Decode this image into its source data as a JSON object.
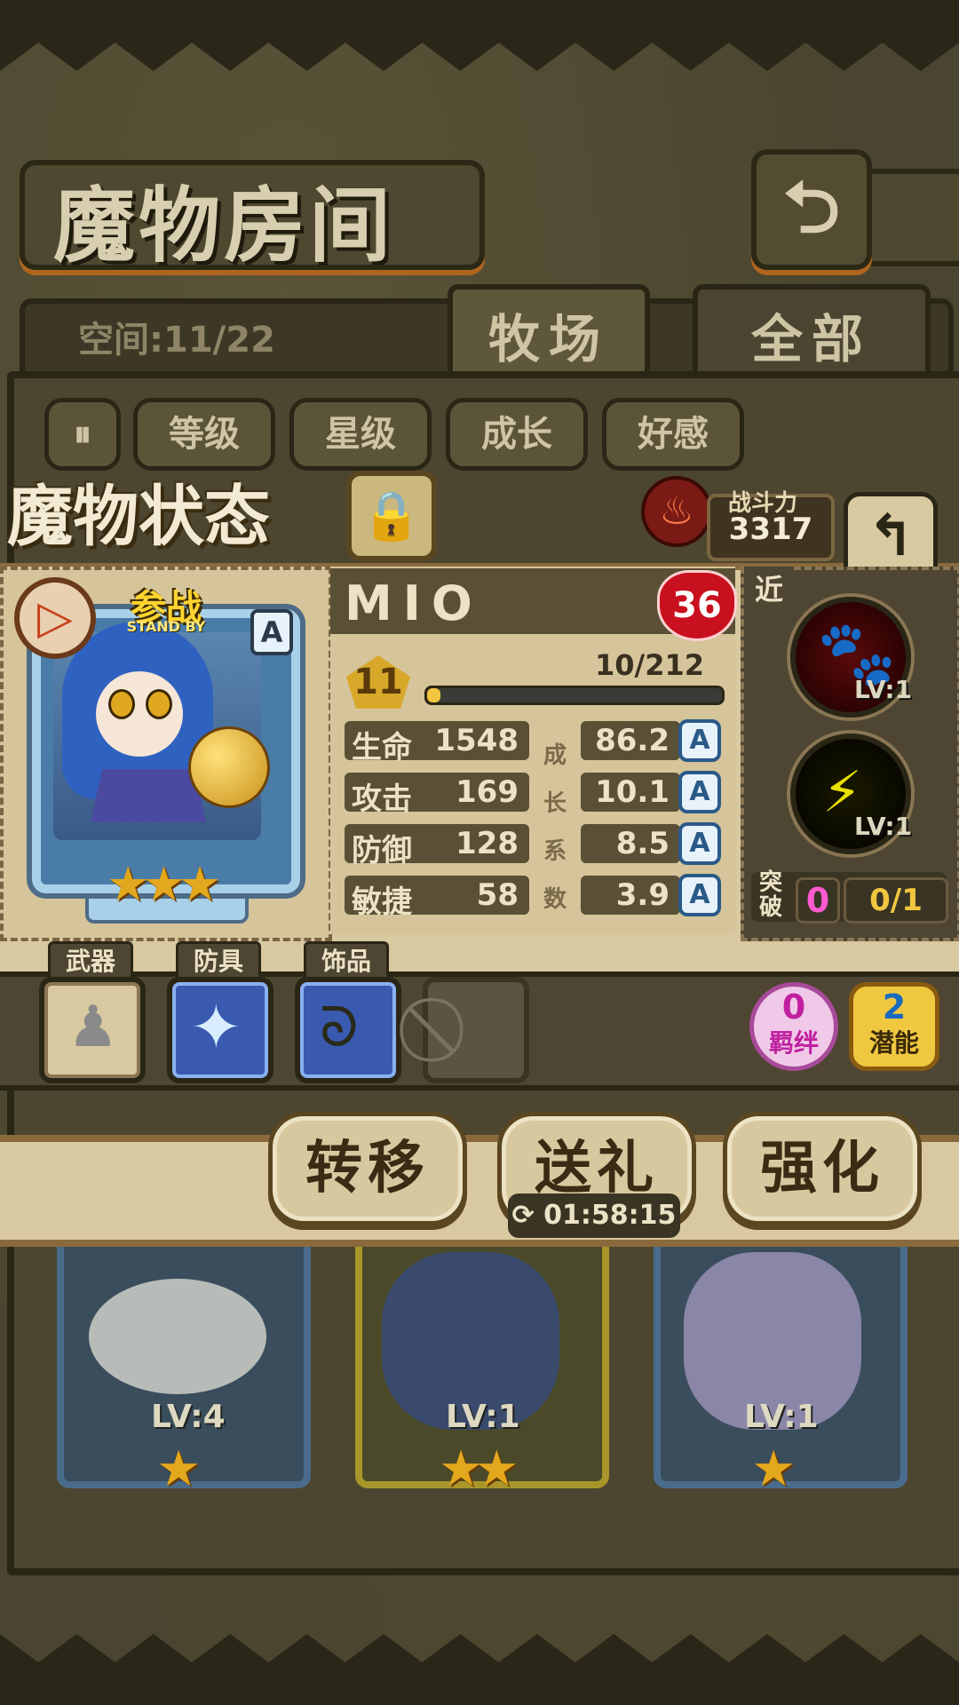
{
  "header": {
    "title": "魔物房间",
    "back_icon": "return-arrow-icon"
  },
  "space": {
    "label": "空间:11/22"
  },
  "tabs": [
    {
      "label": "牧场",
      "active": true
    },
    {
      "label": "全部",
      "active": false
    }
  ],
  "sort_buttons": [
    "等级",
    "星级",
    "成长",
    "好感"
  ],
  "status_panel": {
    "title": "魔物状态",
    "power_label": "战斗力",
    "power_value": "3317",
    "monster": {
      "name": "MIO",
      "standby_label": "参战",
      "standby_sub": "STAND BY",
      "rank": "A",
      "stars": 3,
      "affection": "36",
      "level": "11",
      "exp_text": "10/212",
      "exp_progress": 0.047,
      "stats": [
        {
          "label": "生命",
          "value": "1548",
          "growth": "86.2",
          "grade": "A"
        },
        {
          "label": "攻击",
          "value": "169",
          "growth": "10.1",
          "grade": "A"
        },
        {
          "label": "防御",
          "value": "128",
          "growth": "8.5",
          "grade": "A"
        },
        {
          "label": "敏捷",
          "value": "58",
          "growth": "3.9",
          "grade": "A"
        }
      ],
      "growth_label_chars": [
        "成",
        "长",
        "系",
        "数"
      ],
      "range_tag": "近",
      "skills": [
        {
          "icon": "paw-skill-icon",
          "level": "LV:1"
        },
        {
          "icon": "lightning-skill-icon",
          "level": "LV:1"
        }
      ],
      "breakthrough": {
        "label": "突破",
        "count": "0",
        "progress": "0/1"
      }
    },
    "equipment": [
      {
        "label": "武器",
        "icon": "statue-weapon-icon"
      },
      {
        "label": "防具",
        "icon": "crystal-armor-icon"
      },
      {
        "label": "饰品",
        "icon": "necklace-accessory-icon"
      }
    ],
    "bond": {
      "count": "0",
      "label": "羁绊"
    },
    "potential": {
      "count": "2",
      "label": "潜能"
    },
    "actions": [
      "转移",
      "送礼",
      "强化"
    ],
    "gift_timer": "01:58:15"
  },
  "background_cards": [
    {
      "level": "LV:4",
      "stars": 1,
      "style": "blue"
    },
    {
      "level": "LV:1",
      "stars": 2,
      "style": "gold"
    },
    {
      "level": "LV:1",
      "stars": 1,
      "style": "blue"
    }
  ],
  "colors": {
    "accent": "#b0651e",
    "parchment": "#d9c9a0",
    "dark_panel": "#4e4632",
    "grade_blue": "#2a5a88",
    "star": "#e3a81e"
  }
}
